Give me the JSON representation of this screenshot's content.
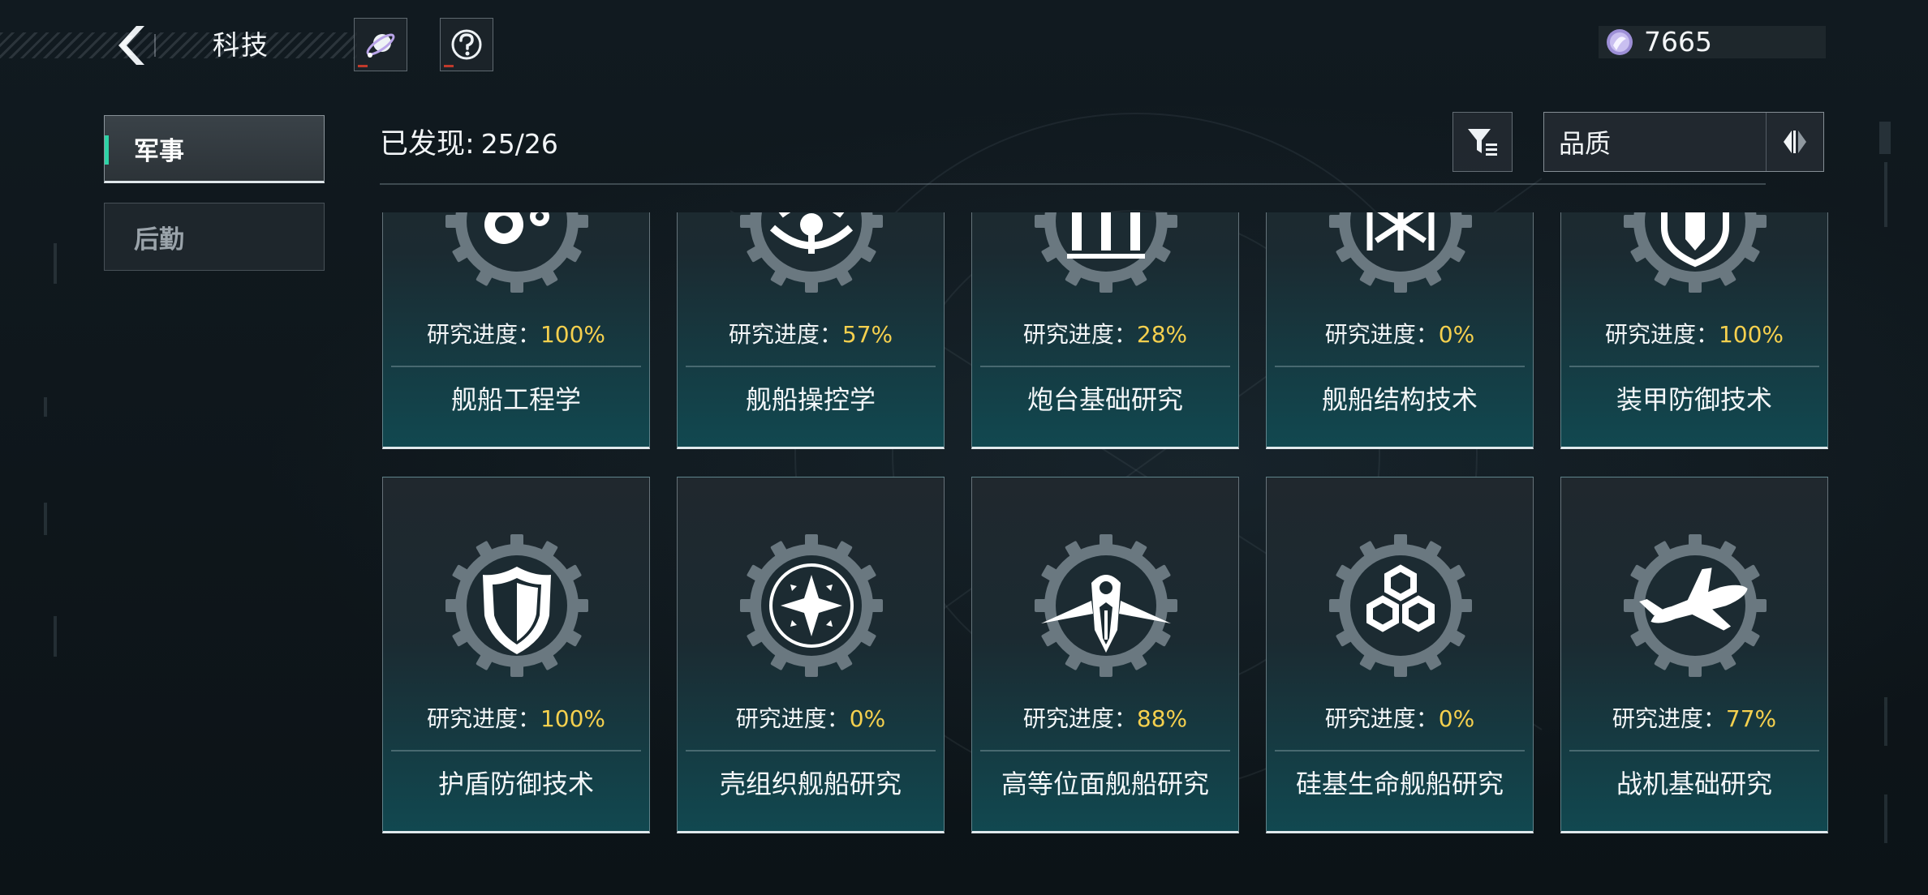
{
  "header": {
    "title": "科技",
    "currency_value": "7665"
  },
  "icons": {
    "back": "back-chevron-icon",
    "planet": "planet-icon",
    "help": "question-mark-icon",
    "currency": "crystal-gem-icon",
    "filter": "filter-funnel-icon",
    "sort": "sort-arrows-icon"
  },
  "tabs": [
    {
      "label": "军事",
      "active": true
    },
    {
      "label": "后勤",
      "active": false
    }
  ],
  "discovery": {
    "label": "已发现:",
    "count": "25/26"
  },
  "sort": {
    "selected": "品质"
  },
  "colors": {
    "accent_tab": "#2ed3a6",
    "percent_text": "#f5d04e",
    "card_bottom": "#114850"
  },
  "progress_prefix": "研究进度：",
  "cards": [
    {
      "name": "舰船工程学",
      "progress": "100%",
      "icon": "gears-icon"
    },
    {
      "name": "舰船操控学",
      "progress": "57%",
      "icon": "steering-wheel-icon"
    },
    {
      "name": "炮台基础研究",
      "progress": "28%",
      "icon": "ammo-shells-icon"
    },
    {
      "name": "舰船结构技术",
      "progress": "0%",
      "icon": "hull-frame-icon"
    },
    {
      "name": "装甲防御技术",
      "progress": "100%",
      "icon": "armor-plate-icon"
    },
    {
      "name": "护盾防御技术",
      "progress": "100%",
      "icon": "shield-icon"
    },
    {
      "name": "壳组织舰船研究",
      "progress": "0%",
      "icon": "four-point-star-icon"
    },
    {
      "name": "高等位面舰船研究",
      "progress": "88%",
      "icon": "winged-ship-icon"
    },
    {
      "name": "硅基生命舰船研究",
      "progress": "0%",
      "icon": "hexagon-cluster-icon"
    },
    {
      "name": "战机基础研究",
      "progress": "77%",
      "icon": "fighter-jet-icon"
    }
  ]
}
